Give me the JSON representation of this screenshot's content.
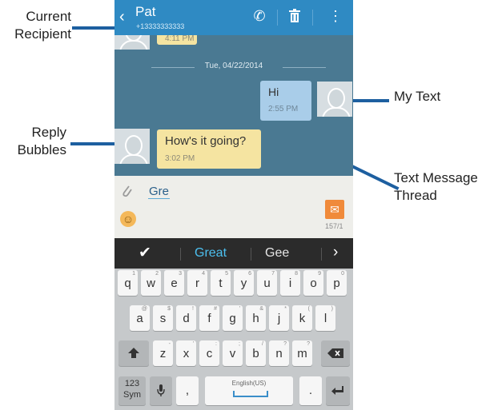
{
  "annotations": {
    "current_recipient": "Current\nRecipient",
    "reply_bubbles": "Reply\nBubbles",
    "my_text": "My Text",
    "text_message_thread": "Text Message\nThread"
  },
  "header": {
    "contact_name": "Pat",
    "contact_number": "+13333333333"
  },
  "thread": {
    "previous_time": "4:11 PM",
    "date_separator": "Tue, 04/22/2014",
    "messages": [
      {
        "direction": "sent",
        "text": "Hi",
        "time": "2:55 PM",
        "bubble_color": "#a9cde9"
      },
      {
        "direction": "received",
        "text": "How's it going?",
        "time": "3:02 PM",
        "bubble_color": "#f5e4a1"
      }
    ]
  },
  "compose": {
    "input_value": "Gre",
    "char_count": "157/1"
  },
  "suggestions": [
    "Great",
    "Gee"
  ],
  "keyboard": {
    "row1": [
      {
        "k": "q",
        "h": "1"
      },
      {
        "k": "w",
        "h": "2"
      },
      {
        "k": "e",
        "h": "3"
      },
      {
        "k": "r",
        "h": "4"
      },
      {
        "k": "t",
        "h": "5"
      },
      {
        "k": "y",
        "h": "6"
      },
      {
        "k": "u",
        "h": "7"
      },
      {
        "k": "i",
        "h": "8"
      },
      {
        "k": "o",
        "h": "9"
      },
      {
        "k": "p",
        "h": "0"
      }
    ],
    "row2": [
      {
        "k": "a",
        "h": "@"
      },
      {
        "k": "s",
        "h": "$"
      },
      {
        "k": "d",
        "h": "!"
      },
      {
        "k": "f",
        "h": "#"
      },
      {
        "k": "g",
        "h": "'"
      },
      {
        "k": "h",
        "h": "&"
      },
      {
        "k": "j",
        "h": "*"
      },
      {
        "k": "k",
        "h": "("
      },
      {
        "k": "l",
        "h": ")"
      }
    ],
    "row3": [
      {
        "k": "z",
        "h": "-"
      },
      {
        "k": "x",
        "h": "'"
      },
      {
        "k": "c",
        "h": ":"
      },
      {
        "k": "v",
        "h": ";"
      },
      {
        "k": "b",
        "h": "/"
      },
      {
        "k": "n",
        "h": "?"
      },
      {
        "k": "m",
        "h": "?"
      }
    ],
    "sym_label_top": "123",
    "sym_label_bottom": "Sym",
    "comma": ",",
    "space_label": "English(US)",
    "period": "."
  },
  "icons": {
    "back": "back-icon",
    "call": "phone-icon",
    "delete": "trash-icon",
    "menu": "more-vertical-icon",
    "attach": "paperclip-icon",
    "emoji": "smiley-icon",
    "send": "send-message-icon",
    "accept": "checkmark-icon",
    "more_suggestions": "chevron-right-icon",
    "shift": "shift-icon",
    "backspace": "backspace-icon",
    "mic": "microphone-icon",
    "enter": "enter-icon"
  },
  "colors": {
    "header_bg": "#2f8ac3",
    "thread_bg": "#4a7992",
    "callout_line": "#1d5fa0",
    "suggestion_active": "#4cc0f0"
  }
}
